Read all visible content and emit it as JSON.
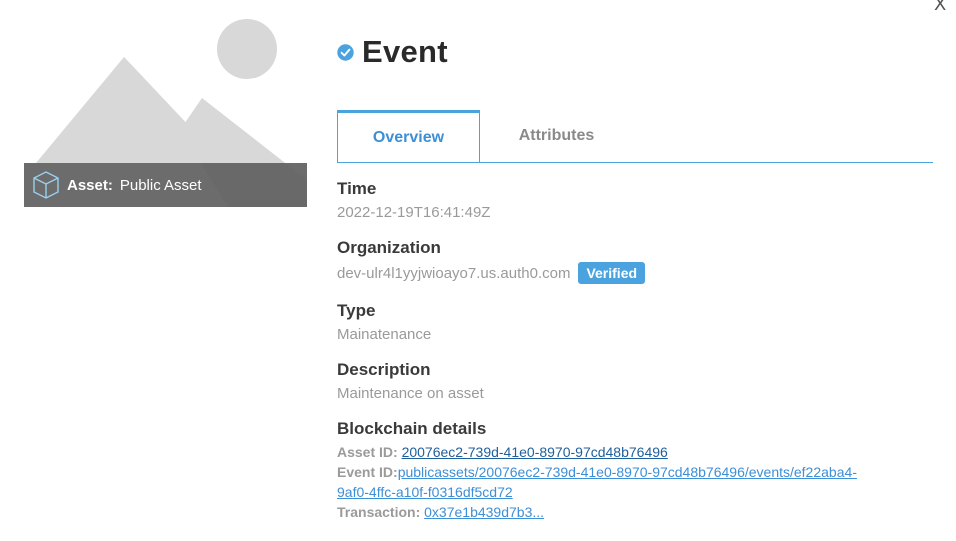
{
  "close_label": "X",
  "hero": {
    "image_icon": "placeholder-image-icon",
    "asset_icon": "cube-icon",
    "asset_key": "Asset:",
    "asset_value": "Public Asset"
  },
  "header": {
    "verified_icon": "check-circle-icon",
    "title": "Event"
  },
  "tabs": [
    {
      "label": "Overview",
      "active": true
    },
    {
      "label": "Attributes",
      "active": false
    }
  ],
  "fields": {
    "time": {
      "label": "Time",
      "value": "2022-12-19T16:41:49Z"
    },
    "organization": {
      "label": "Organization",
      "value": "dev-ulr4l1yyjwioayo7.us.auth0.com",
      "badge": "Verified"
    },
    "type": {
      "label": "Type",
      "value": "Mainatenance"
    },
    "description": {
      "label": "Description",
      "value": "Maintenance on asset"
    }
  },
  "blockchain": {
    "label": "Blockchain details",
    "asset_id_key": "Asset ID:",
    "asset_id_value": "20076ec2-739d-41e0-8970-97cd48b76496",
    "event_id_key": "Event ID:",
    "event_id_line1": "publicassets/20076ec2-739d-41e0-8970-97cd48b76496/events/ef22aba4-",
    "event_id_line2": "9af0-4ffc-a10f-f0316df5cd72",
    "transaction_key": "Transaction:",
    "transaction_value": "0x37e1b439d7b3..."
  },
  "colors": {
    "accent": "#4aa3df",
    "asset_bar": "#5f5f5f",
    "placeholder": "#d8d8d8"
  }
}
